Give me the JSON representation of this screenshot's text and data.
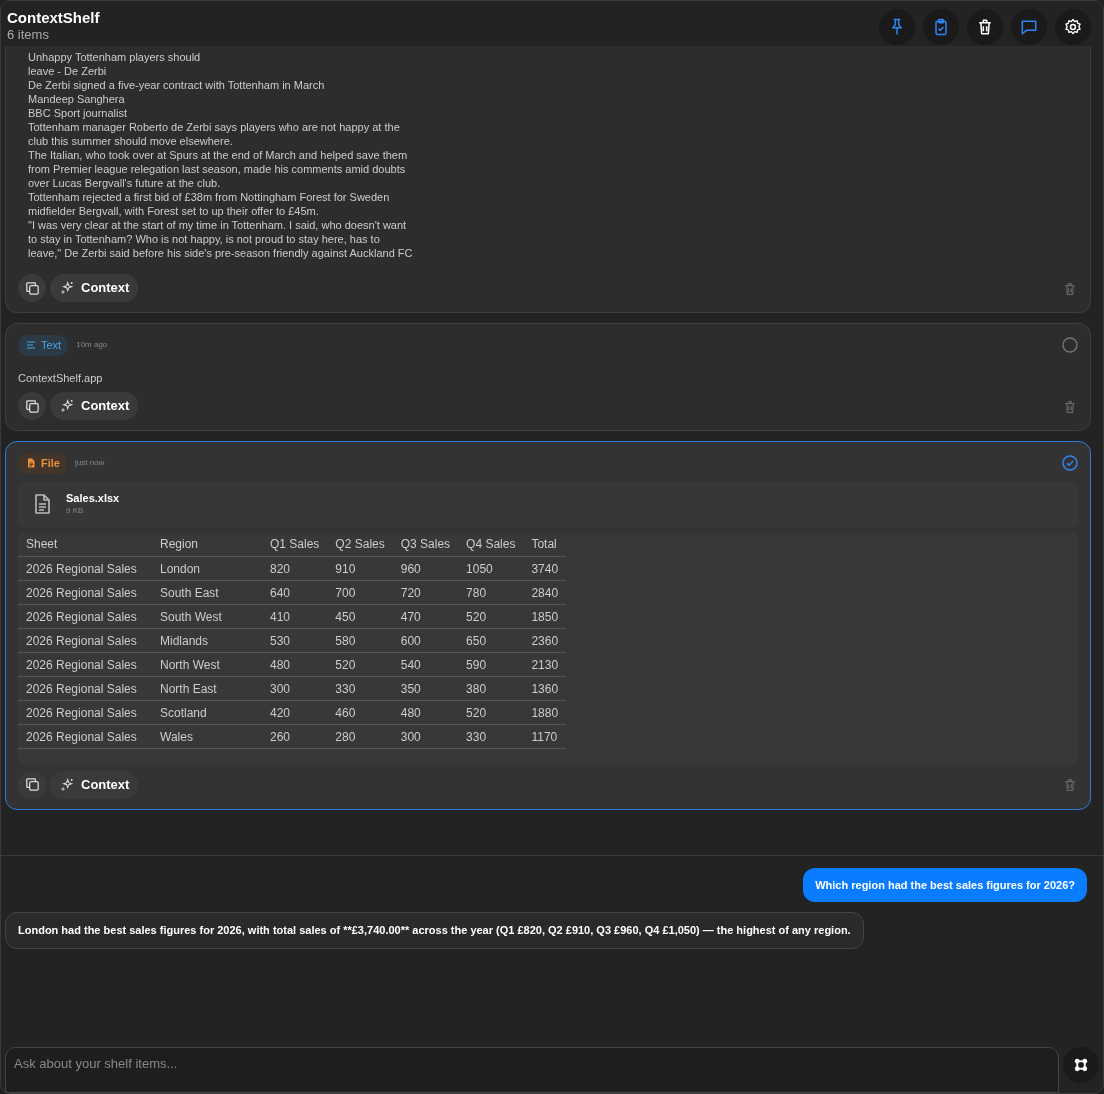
{
  "app": {
    "title": "ContextShelf",
    "subtitle": "6 items"
  },
  "toolbar": [
    {
      "kind": "pin",
      "active": true
    },
    {
      "kind": "clipboard",
      "active": true
    },
    {
      "kind": "trash",
      "active": false
    },
    {
      "kind": "chat",
      "active": true
    },
    {
      "kind": "settings",
      "active": false
    }
  ],
  "items": [
    {
      "kind": "article",
      "lines": [
        "Unhappy Tottenham players should",
        "leave - De Zerbi",
        "De Zerbi signed a five-year contract with Tottenham in March",
        "Mandeep Sanghera",
        "BBC Sport journalist",
        "Tottenham manager Roberto de Zerbi says players who are not happy at the",
        "club this summer should move elsewhere.",
        "The Italian, who took over at Spurs at the end of March and helped save them",
        "from Premier league relegation last season, made his comments amid doubts",
        "over Lucas Bergvall's future at the club.",
        "Tottenham rejected a first bid of £38m from Nottingham Forest for Sweden",
        "midfielder Bergvall, with Forest set to up their offer to £45m.",
        "\"I was very clear at the start of my time in Tottenham. I said, who doesn't want",
        "to stay in Tottenham? Who is not happy, is not proud to stay here, has to",
        "leave,\" De Zerbi said before his side's pre-season friendly against Auckland FC"
      ],
      "context_label": "Context"
    },
    {
      "kind": "text",
      "badge": "Text",
      "time": "10m ago",
      "selected": false,
      "body": "ContextShelf.app",
      "context_label": "Context"
    },
    {
      "kind": "file",
      "badge": "File",
      "time": "just now",
      "selected": true,
      "file": {
        "name": "Sales.xlsx",
        "size": "9 KB"
      },
      "table": {
        "columns": [
          "Sheet",
          "Region",
          "Q1 Sales",
          "Q2 Sales",
          "Q3 Sales",
          "Q4 Sales",
          "Total"
        ],
        "rows": [
          [
            "2026 Regional Sales",
            "London",
            "820",
            "910",
            "960",
            "1050",
            "3740"
          ],
          [
            "2026 Regional Sales",
            "South East",
            "640",
            "700",
            "720",
            "780",
            "2840"
          ],
          [
            "2026 Regional Sales",
            "South West",
            "410",
            "450",
            "470",
            "520",
            "1850"
          ],
          [
            "2026 Regional Sales",
            "Midlands",
            "530",
            "580",
            "600",
            "650",
            "2360"
          ],
          [
            "2026 Regional Sales",
            "North West",
            "480",
            "520",
            "540",
            "590",
            "2130"
          ],
          [
            "2026 Regional Sales",
            "North East",
            "300",
            "330",
            "350",
            "380",
            "1360"
          ],
          [
            "2026 Regional Sales",
            "Scotland",
            "420",
            "460",
            "480",
            "520",
            "1880"
          ],
          [
            "2026 Regional Sales",
            "Wales",
            "260",
            "280",
            "300",
            "330",
            "1170"
          ]
        ]
      },
      "context_label": "Context"
    }
  ],
  "chat": [
    {
      "kind": "user",
      "text": "Which region had the best sales figures for 2026?"
    },
    {
      "kind": "assistant",
      "text": "London had the best sales figures for 2026, with total sales of **£3,740.00** across the year (Q1 £820, Q2 £910, Q3 £960, Q4 £1,050) — the highest of any region."
    }
  ],
  "input": {
    "placeholder": "Ask about your shelf items..."
  }
}
